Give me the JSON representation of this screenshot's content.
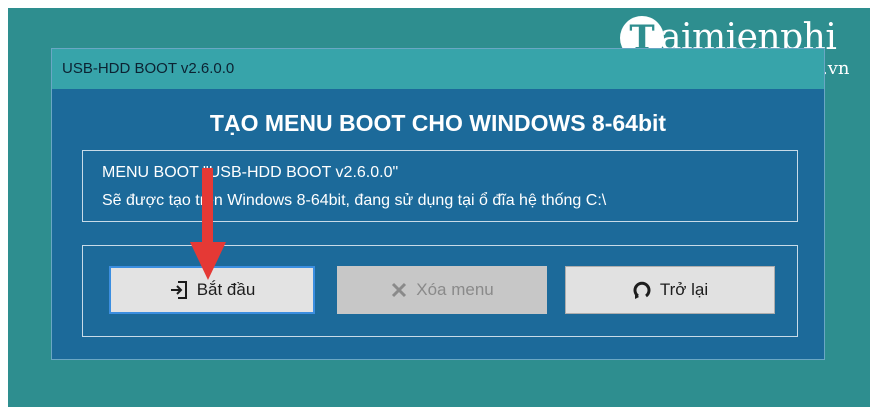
{
  "watermark": {
    "logo_letter": "T",
    "brand": "aimienphi",
    "domain": ".vn"
  },
  "window": {
    "title": "USB-HDD BOOT v2.6.0.0",
    "heading": "TẠO MENU BOOT CHO WINDOWS 8-64bit",
    "info": {
      "line1": "MENU BOOT \"USB-HDD BOOT v2.6.0.0\"",
      "line2": "Sẽ được tạo trên Windows 8-64bit, đang sử dụng tại ổ đĩa hệ thống C:\\"
    },
    "buttons": {
      "start": {
        "label": "Bắt đầu",
        "icon": "sign-in-icon",
        "enabled": true
      },
      "delete": {
        "label": "Xóa menu",
        "icon": "x-icon",
        "enabled": false
      },
      "back": {
        "label": "Trở lại",
        "icon": "refresh-icon",
        "enabled": true
      }
    }
  },
  "colors": {
    "background": "#2e8e8f",
    "titlebar": "#37a4aa",
    "window_body": "#1c6a9a",
    "annotation_arrow": "#e53935"
  }
}
